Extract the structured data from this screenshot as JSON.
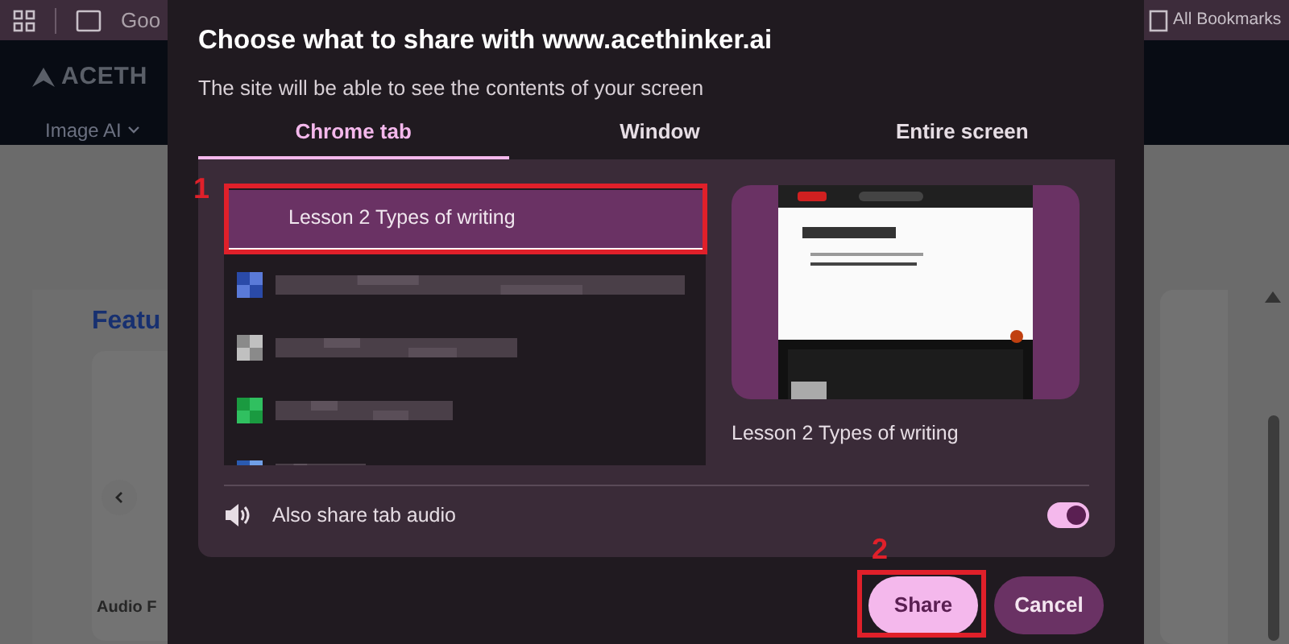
{
  "background_left": {
    "bookmark": "Goo",
    "logo": "ACETH",
    "menu": "Image AI",
    "heading": "Featu",
    "card_label": "Audio F"
  },
  "background_right": {
    "bookmarks": "All Bookmarks"
  },
  "dialog": {
    "title": "Choose what to share with www.acethinker.ai",
    "subtitle": "The site will be able to see the contents of your screen",
    "tabs": [
      {
        "label": "Chrome tab",
        "selected": true
      },
      {
        "label": "Window",
        "selected": false
      },
      {
        "label": "Entire screen",
        "selected": false
      }
    ],
    "tab_list": [
      {
        "kind": "title",
        "label": "Lesson 2 Types of writing",
        "selected": true
      },
      {
        "kind": "redacted",
        "selected": false
      },
      {
        "kind": "redacted",
        "selected": false
      },
      {
        "kind": "redacted",
        "selected": false
      },
      {
        "kind": "redacted",
        "selected": false
      }
    ],
    "preview": {
      "kind": "picture",
      "caption": "Lesson 2 Types of writing"
    },
    "audio": {
      "label": "Also share tab audio",
      "on": true
    },
    "buttons": [
      {
        "label": "Share",
        "kind": "primary"
      },
      {
        "label": "Cancel",
        "kind": "secondary"
      }
    ]
  },
  "annotations": [
    "1",
    "2"
  ]
}
